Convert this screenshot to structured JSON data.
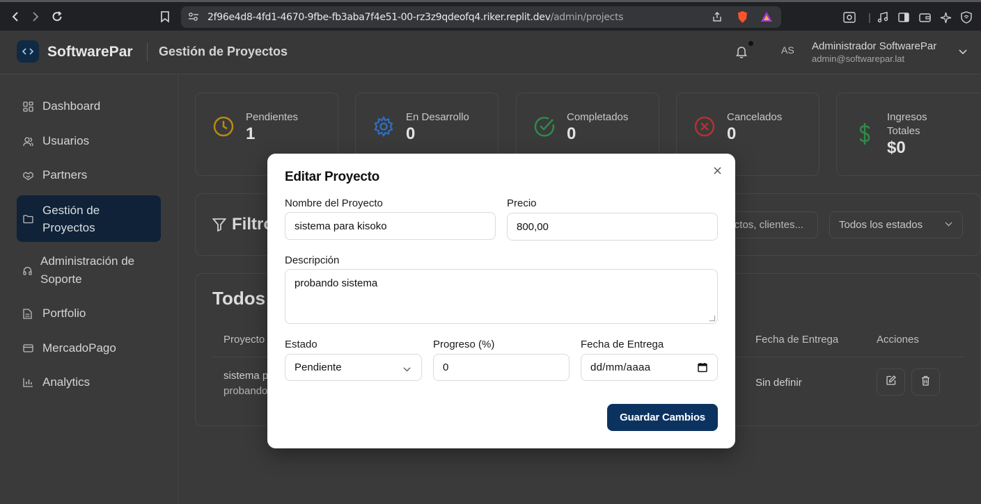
{
  "browser": {
    "url_host": "2f96e4d8-4fd1-4670-9fbe-fb3aba7f4e51-00-rz3z9qdeofq4.riker.replit.dev",
    "url_path": "/admin/projects"
  },
  "header": {
    "logo_icon": "code-brackets-icon",
    "brand": "SoftwarePar",
    "page_title": "Gestión de Proyectos",
    "avatar_initials": "AS",
    "user_name": "Administrador SoftwarePar",
    "user_email": "admin@softwarepar.lat"
  },
  "sidebar": {
    "items": [
      {
        "label": "Dashboard",
        "icon": "grid-icon"
      },
      {
        "label": "Usuarios",
        "icon": "users-icon"
      },
      {
        "label": "Partners",
        "icon": "handshake-icon"
      },
      {
        "label": "Gestión de Proyectos",
        "icon": "folder-icon",
        "active": true
      },
      {
        "label": "Administración de Soporte",
        "icon": "headphones-icon"
      },
      {
        "label": "Portfolio",
        "icon": "document-icon"
      },
      {
        "label": "MercadoPago",
        "icon": "credit-card-icon"
      },
      {
        "label": "Analytics",
        "icon": "bar-chart-icon"
      }
    ]
  },
  "stats": [
    {
      "label": "Pendientes",
      "value": "1",
      "icon": "clock-icon",
      "color": "#b88a12"
    },
    {
      "label": "En Desarrollo",
      "value": "0",
      "icon": "gear-icon",
      "color": "#2f6fc0"
    },
    {
      "label": "Completados",
      "value": "0",
      "icon": "check-circle-icon",
      "color": "#2e8b47"
    },
    {
      "label": "Cancelados",
      "value": "0",
      "icon": "x-circle-icon",
      "color": "#b3322e"
    },
    {
      "label": "Ingresos Totales",
      "value": "$0",
      "icon": "dollar-icon",
      "color": "#2e8b47"
    }
  ],
  "filters": {
    "title": "Filtros",
    "search_placeholder": "Buscar proyectos, clientes...",
    "status_value": "Todos los estados"
  },
  "table": {
    "title": "Todos los Proyectos",
    "headers": [
      "Proyecto",
      "Fecha de Entrega",
      "Acciones"
    ],
    "row": {
      "name": "sistema para kisoko",
      "description": "probando sistema",
      "delivery": "Sin definir"
    }
  },
  "modal": {
    "title": "Editar Proyecto",
    "name_label": "Nombre del Proyecto",
    "name_value": "sistema para kisoko",
    "price_label": "Precio",
    "price_value": "800,00",
    "description_label": "Descripción",
    "description_value": "probando sistema",
    "status_label": "Estado",
    "status_value": "Pendiente",
    "progress_label": "Progreso (%)",
    "progress_value": "0",
    "date_label": "Fecha de Entrega",
    "date_placeholder": "dd/mm/aaaa",
    "save_label": "Guardar Cambios",
    "accent": "#0c3360"
  }
}
